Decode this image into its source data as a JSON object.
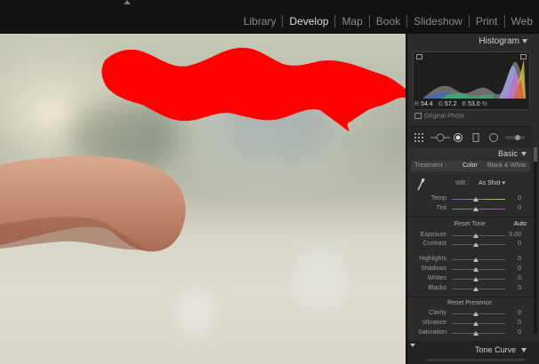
{
  "modules": [
    {
      "label": "Library",
      "active": false
    },
    {
      "label": "Develop",
      "active": true
    },
    {
      "label": "Map",
      "active": false
    },
    {
      "label": "Book",
      "active": false
    },
    {
      "label": "Slideshow",
      "active": false
    },
    {
      "label": "Print",
      "active": false
    },
    {
      "label": "Web",
      "active": false
    }
  ],
  "histogram": {
    "title": "Histogram",
    "r_label": "R",
    "r_value": "54.4",
    "g_label": "G",
    "g_value": "57.2",
    "b_label": "B",
    "b_value": "53.0",
    "unit": "%",
    "original_photo": "Original Photo"
  },
  "basic": {
    "title": "Basic",
    "treatment_label": "Treatment :",
    "treatment_color": "Color",
    "treatment_bw": "Black & White",
    "wb_label": "WB :",
    "wb_value": "As Shot",
    "temp": {
      "label": "Temp",
      "value": "0"
    },
    "tint": {
      "label": "Tint",
      "value": "0"
    },
    "reset_tone": "Reset Tone",
    "auto": "Auto",
    "exposure": {
      "label": "Exposure",
      "value": "0.00"
    },
    "contrast": {
      "label": "Contrast",
      "value": "0"
    },
    "highlights": {
      "label": "Highlights",
      "value": "0"
    },
    "shadows": {
      "label": "Shadows",
      "value": "0"
    },
    "whites": {
      "label": "Whites",
      "value": "0"
    },
    "blacks": {
      "label": "Blacks",
      "value": "0"
    },
    "reset_presence": "Reset Presence",
    "clarity": {
      "label": "Clarity",
      "value": "0"
    },
    "vibrance": {
      "label": "Vibrance",
      "value": "0"
    },
    "saturation": {
      "label": "Saturation",
      "value": "0"
    }
  },
  "tone_curve": {
    "title": "Tone Curve"
  },
  "colors": {
    "redact": "#ff0000",
    "panel": "#2b2b2b",
    "topbar": "#121212"
  }
}
